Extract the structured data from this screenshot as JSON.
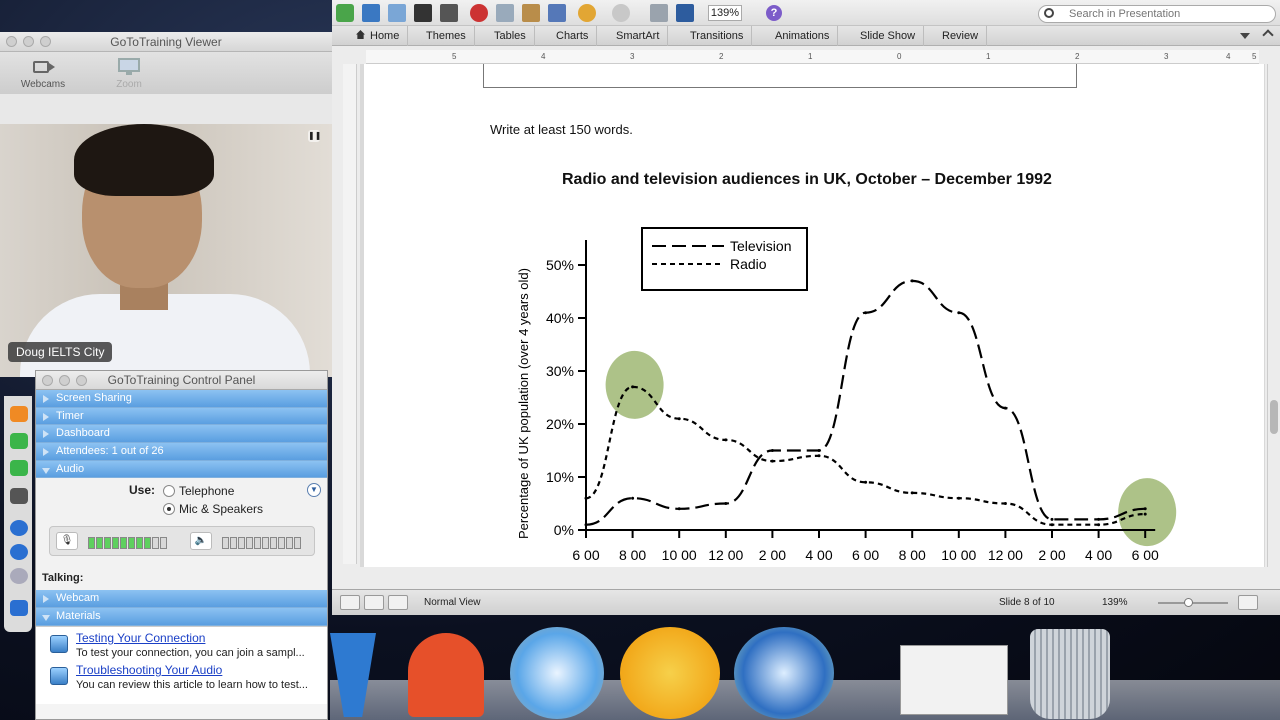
{
  "viewer": {
    "title": "GoToTraining Viewer",
    "webcams_label": "Webcams",
    "zoom_label": "Zoom",
    "presenter_name": "Doug IELTS City"
  },
  "control_panel": {
    "title": "GoToTraining Control Panel",
    "sections": {
      "screen_sharing": "Screen Sharing",
      "timer": "Timer",
      "dashboard": "Dashboard",
      "attendees": "Attendees: 1 out of 26",
      "audio": "Audio",
      "webcam": "Webcam",
      "materials": "Materials"
    },
    "audio": {
      "use_label": "Use:",
      "option_telephone": "Telephone",
      "option_mic": "Mic & Speakers",
      "selected": "Mic & Speakers",
      "mic_level": 0.78,
      "speaker_level": 0.0
    },
    "talking_label": "Talking:",
    "materials": [
      {
        "title": "Testing Your Connection",
        "description": "To test your connection, you can join a sampl..."
      },
      {
        "title": "Troubleshooting Your Audio",
        "description": "You can review this article to learn how to test..."
      }
    ]
  },
  "powerpoint": {
    "zoom": "139%",
    "search_placeholder": "Search in Presentation",
    "tabs": [
      "Home",
      "Themes",
      "Tables",
      "Charts",
      "SmartArt",
      "Transitions",
      "Animations",
      "Slide Show",
      "Review"
    ],
    "ruler_labels": [
      "5",
      "4",
      "3",
      "2",
      "1",
      "0",
      "1",
      "2",
      "3",
      "4",
      "5"
    ],
    "view_mode": "Normal View",
    "slide_position": "Slide 8 of 10",
    "zoom_status": "139%"
  },
  "slide": {
    "prompt": "Write at least 150 words.",
    "chart_title": "Radio and television audiences in UK, October – December 1992"
  },
  "chart_data": {
    "type": "line",
    "title": "Radio and television audiences in UK, October – December 1992",
    "ylabel": "Percentage of UK population (over 4 years old)",
    "xlabel": "",
    "x": [
      "6 00",
      "8 00",
      "10 00",
      "12 00",
      "2 00",
      "4 00",
      "6 00",
      "8 00",
      "10 00",
      "12 00",
      "2 00",
      "4 00",
      "6 00"
    ],
    "ytick_labels": [
      "0%",
      "10%",
      "20%",
      "30%",
      "40%",
      "50%"
    ],
    "ylim": [
      0,
      50
    ],
    "legend_position": "top",
    "series": [
      {
        "name": "Television",
        "style": "long-dash",
        "values": [
          1,
          6,
          4,
          5,
          15,
          15,
          41,
          47,
          41,
          23,
          2,
          2,
          4
        ]
      },
      {
        "name": "Radio",
        "style": "short-dash",
        "values": [
          6,
          27,
          21,
          17,
          13,
          14,
          9,
          7,
          6,
          5,
          1,
          1,
          3
        ]
      }
    ],
    "highlights": [
      {
        "x_index": 1,
        "value": 27,
        "color": "#98b36a"
      },
      {
        "x_index": 12,
        "value": 3,
        "color": "#98b36a"
      }
    ]
  },
  "dock": {
    "apps": [
      "word-icon",
      "powerpoint-icon",
      "safari-icon",
      "gotomeeting-icon",
      "quicktime-icon",
      "preview-icon",
      "trash-icon"
    ]
  }
}
